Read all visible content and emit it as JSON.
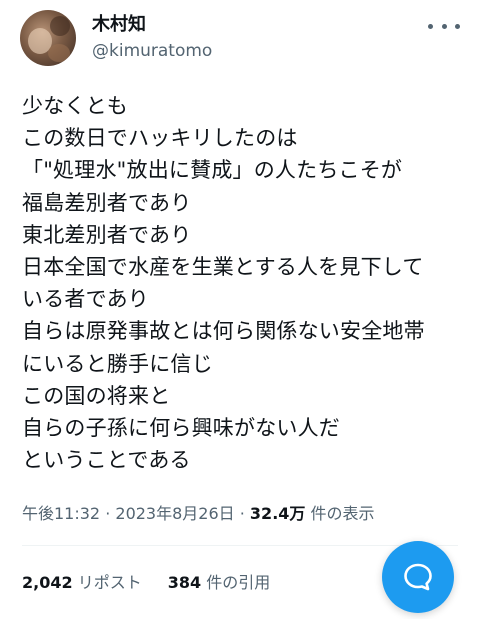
{
  "author": {
    "name": "木村知",
    "handle": "@kimuratomo"
  },
  "post": {
    "lines": [
      "少なくとも",
      "この数日でハッキリしたのは",
      "「\"処理水\"放出に賛成」の人たちこそが",
      "福島差別者であり",
      "東北差別者であり",
      "日本全国で水産を生業とする人を見下して",
      "いる者であり",
      "自らは原発事故とは何ら関係ない安全地帯",
      "にいると勝手に信じ",
      "この国の将来と",
      "自らの子孫に何ら興味がない人だ",
      "ということである"
    ]
  },
  "meta": {
    "time": "午後11:32",
    "date": "2023年8月26日",
    "views_count": "32.4万",
    "views_label": "件の表示"
  },
  "stats": {
    "reposts_count": "2,042",
    "reposts_label": "リポスト",
    "quotes_count": "384",
    "quotes_label": "件の引用"
  },
  "icons": {
    "more": "more-dots-icon",
    "compose": "compose-icon"
  },
  "colors": {
    "accent": "#1d9bf0",
    "text": "#0f1419",
    "secondary": "#536471"
  }
}
